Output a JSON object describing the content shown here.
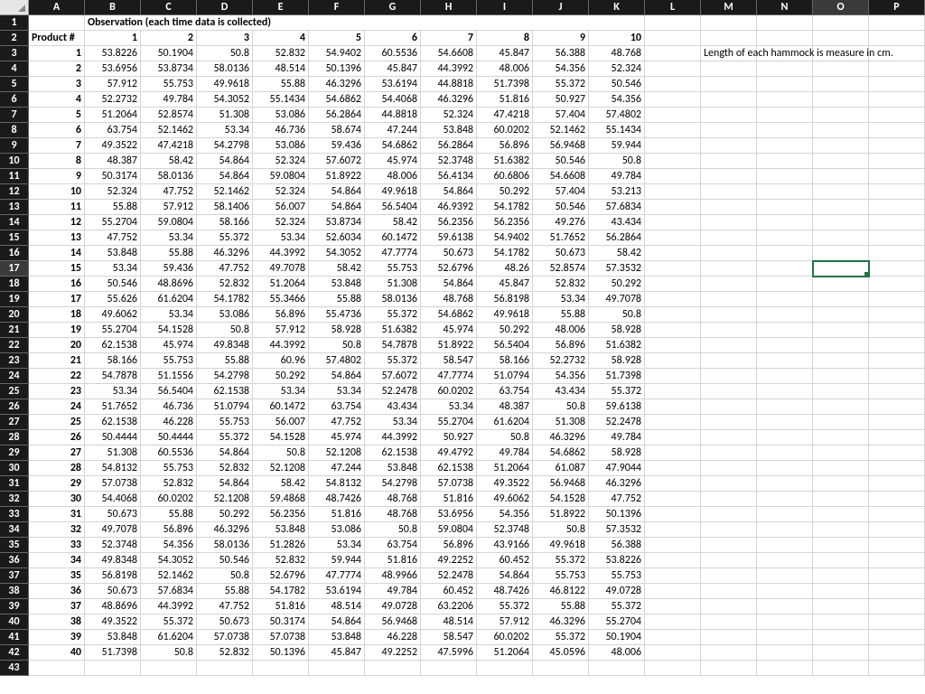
{
  "columns": [
    "A",
    "B",
    "C",
    "D",
    "E",
    "F",
    "G",
    "H",
    "I",
    "J",
    "K",
    "L",
    "M",
    "N",
    "O",
    "P"
  ],
  "num_rows": 43,
  "active_col_index": 14,
  "active_row_index": 16,
  "selected_cell": {
    "row": 17,
    "col": "O"
  },
  "merged_title": {
    "row": 1,
    "start_col": 1,
    "text": "Observation (each time data is collected)"
  },
  "note_cell": {
    "row": 3,
    "col": "M",
    "text": "Length of each hammock is measure in cm."
  },
  "header_row": {
    "row": 2,
    "A": "Product #",
    "B": "1",
    "C": "2",
    "D": "3",
    "E": "4",
    "F": "5",
    "G": "6",
    "H": "7",
    "I": "8",
    "J": "9",
    "K": "10"
  },
  "chart_data": {
    "type": "table",
    "title": "Observation (each time data is collected)",
    "note": "Length of each hammock is measure in cm.",
    "columns": [
      "Product #",
      "1",
      "2",
      "3",
      "4",
      "5",
      "6",
      "7",
      "8",
      "9",
      "10"
    ],
    "rows": [
      [
        1,
        53.8226,
        50.1904,
        50.8,
        52.832,
        54.9402,
        60.5536,
        54.6608,
        45.847,
        56.388,
        48.768
      ],
      [
        2,
        53.6956,
        53.8734,
        58.0136,
        48.514,
        50.1396,
        45.847,
        44.3992,
        48.006,
        54.356,
        52.324
      ],
      [
        3,
        57.912,
        55.753,
        49.9618,
        55.88,
        46.3296,
        53.6194,
        44.8818,
        51.7398,
        55.372,
        50.546
      ],
      [
        4,
        52.2732,
        49.784,
        54.3052,
        55.1434,
        54.6862,
        54.4068,
        46.3296,
        51.816,
        50.927,
        54.356
      ],
      [
        5,
        51.2064,
        52.8574,
        51.308,
        53.086,
        56.2864,
        44.8818,
        52.324,
        47.4218,
        57.404,
        57.4802
      ],
      [
        6,
        63.754,
        52.1462,
        53.34,
        46.736,
        58.674,
        47.244,
        53.848,
        60.0202,
        52.1462,
        55.1434
      ],
      [
        7,
        49.3522,
        47.4218,
        54.2798,
        53.086,
        59.436,
        54.6862,
        56.2864,
        56.896,
        56.9468,
        59.944
      ],
      [
        8,
        48.387,
        58.42,
        54.864,
        52.324,
        57.6072,
        45.974,
        52.3748,
        51.6382,
        50.546,
        50.8
      ],
      [
        9,
        50.3174,
        58.0136,
        54.864,
        59.0804,
        51.8922,
        48.006,
        56.4134,
        60.6806,
        54.6608,
        49.784
      ],
      [
        10,
        52.324,
        47.752,
        52.1462,
        52.324,
        54.864,
        49.9618,
        54.864,
        50.292,
        57.404,
        53.213
      ],
      [
        11,
        55.88,
        57.912,
        58.1406,
        56.007,
        54.864,
        56.5404,
        46.9392,
        54.1782,
        50.546,
        57.6834
      ],
      [
        12,
        55.2704,
        59.0804,
        58.166,
        52.324,
        53.8734,
        58.42,
        56.2356,
        56.2356,
        49.276,
        43.434
      ],
      [
        13,
        47.752,
        53.34,
        55.372,
        53.34,
        52.6034,
        60.1472,
        59.6138,
        54.9402,
        51.7652,
        56.2864
      ],
      [
        14,
        53.848,
        55.88,
        46.3296,
        44.3992,
        54.3052,
        47.7774,
        50.673,
        54.1782,
        50.673,
        58.42
      ],
      [
        15,
        53.34,
        59.436,
        47.752,
        49.7078,
        58.42,
        55.753,
        52.6796,
        48.26,
        52.8574,
        57.3532
      ],
      [
        16,
        50.546,
        48.8696,
        52.832,
        51.2064,
        53.848,
        51.308,
        54.864,
        45.847,
        52.832,
        50.292
      ],
      [
        17,
        55.626,
        61.6204,
        54.1782,
        55.3466,
        55.88,
        58.0136,
        48.768,
        56.8198,
        53.34,
        49.7078
      ],
      [
        18,
        49.6062,
        53.34,
        53.086,
        56.896,
        55.4736,
        55.372,
        54.6862,
        49.9618,
        55.88,
        50.8
      ],
      [
        19,
        55.2704,
        54.1528,
        50.8,
        57.912,
        58.928,
        51.6382,
        45.974,
        50.292,
        48.006,
        58.928
      ],
      [
        20,
        62.1538,
        45.974,
        49.8348,
        44.3992,
        50.8,
        54.7878,
        51.8922,
        56.5404,
        56.896,
        51.6382
      ],
      [
        21,
        58.166,
        55.753,
        55.88,
        60.96,
        57.4802,
        55.372,
        58.547,
        58.166,
        52.2732,
        58.928
      ],
      [
        22,
        54.7878,
        51.1556,
        54.2798,
        50.292,
        54.864,
        57.6072,
        47.7774,
        51.0794,
        54.356,
        51.7398
      ],
      [
        23,
        53.34,
        56.5404,
        62.1538,
        53.34,
        53.34,
        52.2478,
        60.0202,
        63.754,
        43.434,
        55.372
      ],
      [
        24,
        51.7652,
        46.736,
        51.0794,
        60.1472,
        63.754,
        43.434,
        53.34,
        48.387,
        50.8,
        59.6138
      ],
      [
        25,
        62.1538,
        46.228,
        55.753,
        56.007,
        47.752,
        53.34,
        55.2704,
        61.6204,
        51.308,
        52.2478
      ],
      [
        26,
        50.4444,
        50.4444,
        55.372,
        54.1528,
        45.974,
        44.3992,
        50.927,
        50.8,
        46.3296,
        49.784
      ],
      [
        27,
        51.308,
        60.5536,
        54.864,
        50.8,
        52.1208,
        62.1538,
        49.4792,
        49.784,
        54.6862,
        58.928
      ],
      [
        28,
        54.8132,
        55.753,
        52.832,
        52.1208,
        47.244,
        53.848,
        62.1538,
        51.2064,
        61.087,
        47.9044
      ],
      [
        29,
        57.0738,
        52.832,
        54.864,
        58.42,
        54.8132,
        54.2798,
        57.0738,
        49.3522,
        56.9468,
        46.3296
      ],
      [
        30,
        54.4068,
        60.0202,
        52.1208,
        59.4868,
        48.7426,
        48.768,
        51.816,
        49.6062,
        54.1528,
        47.752
      ],
      [
        31,
        50.673,
        55.88,
        50.292,
        56.2356,
        51.816,
        48.768,
        53.6956,
        54.356,
        51.8922,
        50.1396
      ],
      [
        32,
        49.7078,
        56.896,
        46.3296,
        53.848,
        53.086,
        50.8,
        59.0804,
        52.3748,
        50.8,
        57.3532
      ],
      [
        33,
        52.3748,
        54.356,
        58.0136,
        51.2826,
        53.34,
        63.754,
        56.896,
        43.9166,
        49.9618,
        56.388
      ],
      [
        34,
        49.8348,
        54.3052,
        50.546,
        52.832,
        59.944,
        51.816,
        49.2252,
        60.452,
        55.372,
        53.8226
      ],
      [
        35,
        56.8198,
        52.1462,
        50.8,
        52.6796,
        47.7774,
        48.9966,
        52.2478,
        54.864,
        55.753,
        55.753
      ],
      [
        36,
        50.673,
        57.6834,
        55.88,
        54.1782,
        53.6194,
        49.784,
        60.452,
        48.7426,
        46.8122,
        49.0728
      ],
      [
        37,
        48.8696,
        44.3992,
        47.752,
        51.816,
        48.514,
        49.0728,
        63.2206,
        55.372,
        55.88,
        55.372
      ],
      [
        38,
        49.3522,
        55.372,
        50.673,
        50.3174,
        54.864,
        56.9468,
        48.514,
        57.912,
        46.3296,
        55.2704
      ],
      [
        39,
        53.848,
        61.6204,
        57.0738,
        57.0738,
        53.848,
        46.228,
        58.547,
        60.0202,
        55.372,
        50.1904
      ],
      [
        40,
        51.7398,
        50.8,
        52.832,
        50.1396,
        45.847,
        49.2252,
        47.5996,
        51.2064,
        45.0596,
        48.006
      ]
    ]
  }
}
